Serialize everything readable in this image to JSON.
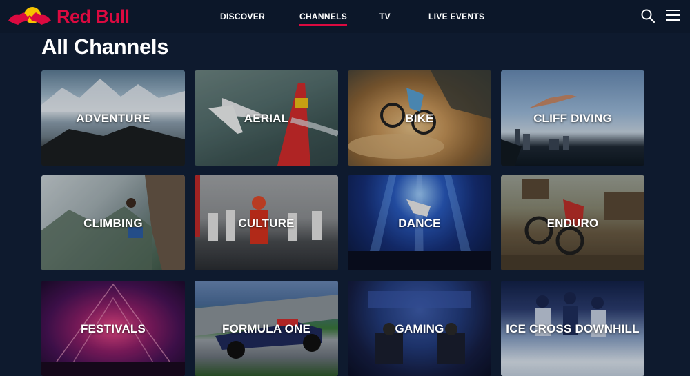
{
  "brand": {
    "name": "Red Bull",
    "color": "#db0a40"
  },
  "nav": {
    "items": [
      {
        "label": "DISCOVER",
        "active": false
      },
      {
        "label": "CHANNELS",
        "active": true
      },
      {
        "label": "TV",
        "active": false
      },
      {
        "label": "LIVE EVENTS",
        "active": false
      }
    ]
  },
  "icons": {
    "search": "search-icon",
    "menu": "hamburger-menu-icon"
  },
  "page": {
    "title": "All Channels"
  },
  "channels": [
    {
      "label": "ADVENTURE"
    },
    {
      "label": "AERIAL"
    },
    {
      "label": "BIKE"
    },
    {
      "label": "CLIFF DIVING"
    },
    {
      "label": "CLIMBING"
    },
    {
      "label": "CULTURE"
    },
    {
      "label": "DANCE"
    },
    {
      "label": "ENDURO"
    },
    {
      "label": "FESTIVALS"
    },
    {
      "label": "FORMULA ONE"
    },
    {
      "label": "GAMING"
    },
    {
      "label": "ICE CROSS DOWNHILL"
    }
  ]
}
